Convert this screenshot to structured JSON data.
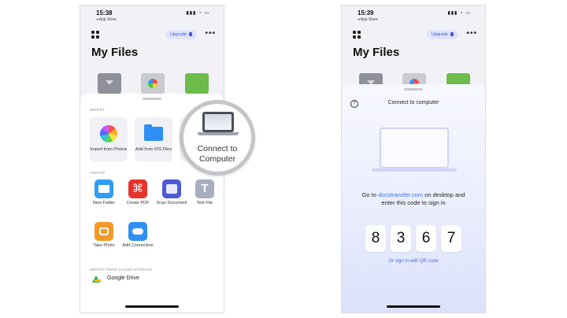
{
  "left": {
    "time": "15:38",
    "back_label": "◂ App Store",
    "status_icons": "▮▮▮ ◔ ▭",
    "upgrade": "Upgrade",
    "more": "•••",
    "title": "My Files",
    "sections": {
      "import": "IMPORT",
      "create": "CREATE",
      "cloud": "IMPORT FROM CLOUD STORAGE"
    },
    "import_tiles": [
      {
        "label": "Import from Photos",
        "icon": "photos-icon"
      },
      {
        "label": "Add from iOS Files",
        "icon": "files-icon"
      }
    ],
    "create_items": [
      {
        "label": "New Folder",
        "icon": "new-folder-icon"
      },
      {
        "label": "Create PDF",
        "icon": "pdf-icon"
      },
      {
        "label": "Scan Document",
        "icon": "scan-icon"
      },
      {
        "label": "Text File",
        "icon": "text-file-icon",
        "glyph": "T"
      },
      {
        "label": "Take Photo",
        "icon": "camera-icon"
      },
      {
        "label": "Add Connection",
        "icon": "cloud-icon"
      }
    ],
    "cloud_item": "Google Drive",
    "magnifier_label": "Connect to Computer"
  },
  "right": {
    "time": "15:39",
    "back_label": "◂ App Store",
    "status_icons": "▮▮▮ ◔ ▭",
    "upgrade": "Upgrade",
    "more": "•••",
    "title": "My Files",
    "help_glyph": "?",
    "sheet_title": "Connect to computer",
    "instr_prefix": "Go to ",
    "instr_link": "docstransfer.com",
    "instr_suffix": " on desktop and enter this code to sign in",
    "code": [
      "8",
      "3",
      "6",
      "7"
    ],
    "qr_link": "Or sign in with QR code"
  },
  "colors": {
    "accent": "#3f6fe0",
    "upgrade_bg": "#dfe3fb"
  }
}
